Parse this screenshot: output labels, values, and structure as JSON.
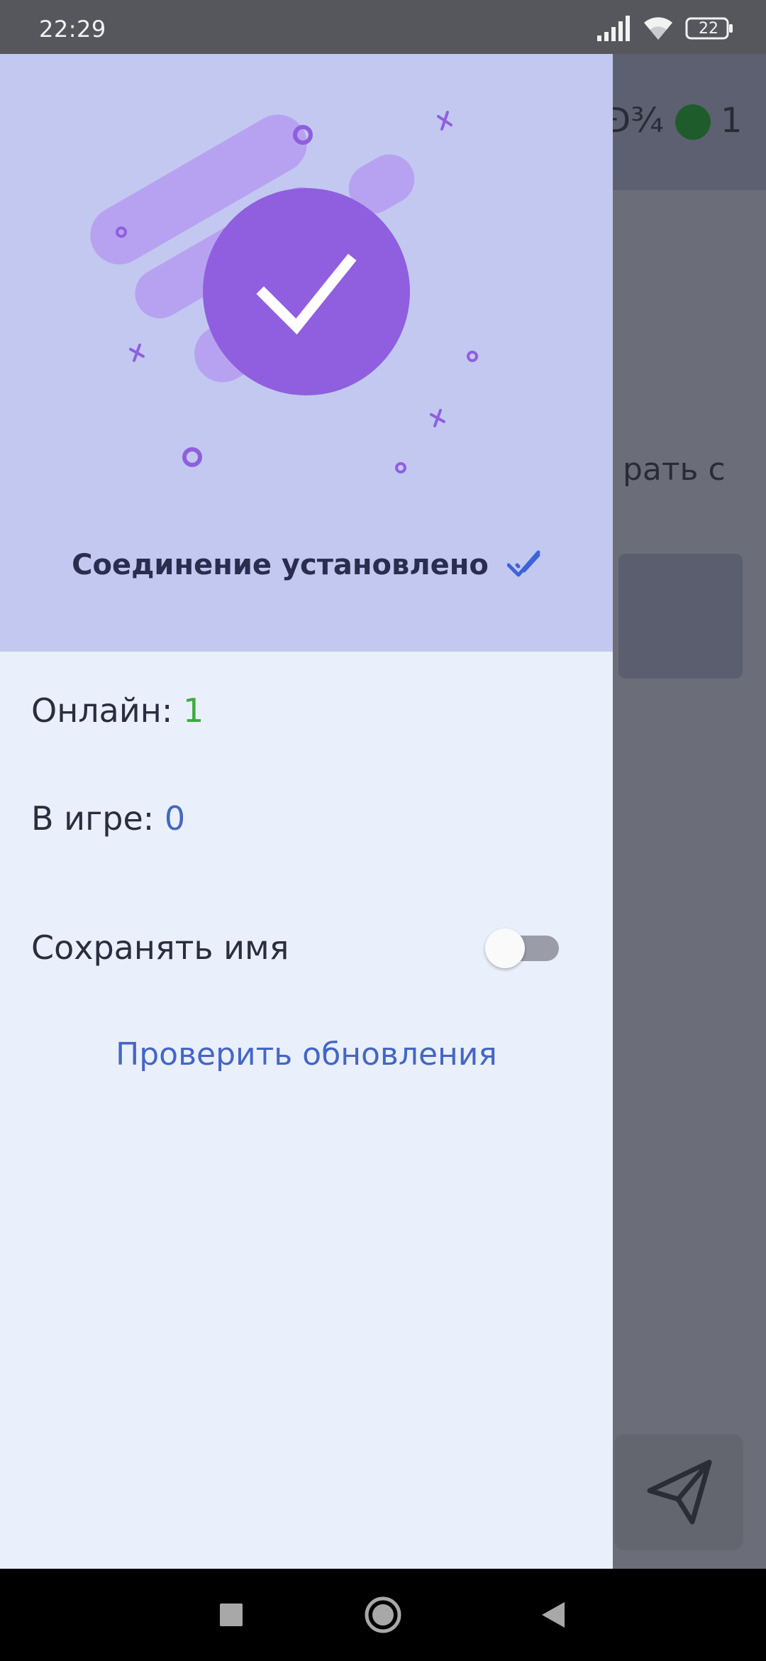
{
  "status_bar": {
    "time": "22:29",
    "battery": "22",
    "icons": [
      "signal-icon",
      "wifi-icon",
      "battery-icon"
    ]
  },
  "background_app": {
    "header_glyph": "Ð¾",
    "online_count": "1",
    "partial_text": "рать с",
    "online_dot_color": "#1e5c2c",
    "send_icon": "send-icon"
  },
  "drawer": {
    "connection_status": "Соединение установлено",
    "connection_icon": "double-check-icon",
    "online_label": "Онлайн: ",
    "online_value": "1",
    "ingame_label": "В игре: ",
    "ingame_value": "0",
    "save_name_label": "Сохранять имя",
    "save_name_enabled": false,
    "check_updates_label": "Проверить обновления",
    "colors": {
      "header_bg": "#c3c8f0",
      "body_bg": "#eaf0fb",
      "accent_purple": "#8f5fdf",
      "online_green": "#3eaa3e",
      "link_blue": "#4466c8"
    }
  },
  "nav_bar": {
    "buttons": [
      "recents-icon",
      "home-icon",
      "back-icon"
    ]
  }
}
